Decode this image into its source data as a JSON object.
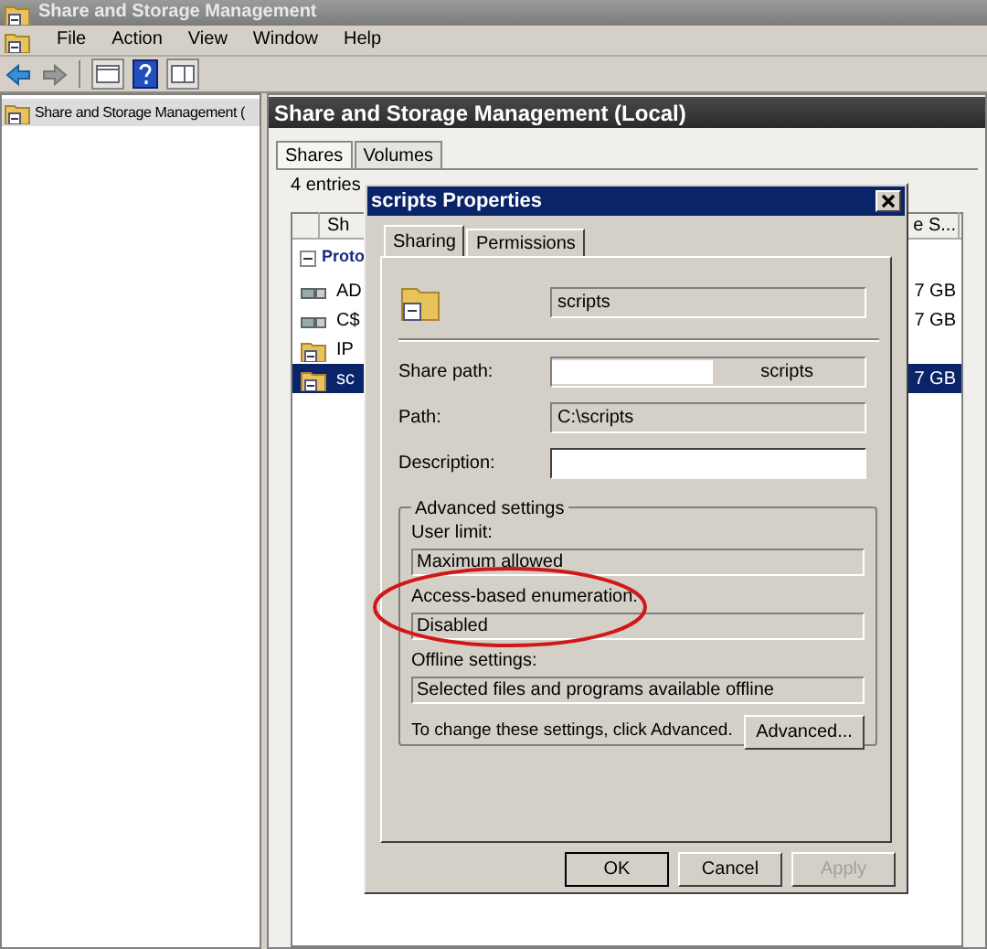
{
  "window": {
    "title": "Share and Storage Management"
  },
  "menu": [
    "File",
    "Action",
    "View",
    "Window",
    "Help"
  ],
  "tree": {
    "items": [
      {
        "label": "Share and Storage Management (",
        "selected": true
      }
    ]
  },
  "pane": {
    "title": "Share and Storage Management (Local)",
    "tabs": [
      {
        "label": "Shares",
        "selected": true
      },
      {
        "label": "Volumes",
        "selected": false
      }
    ],
    "count": "4 entries",
    "columns": [
      "Sh",
      "e S..."
    ],
    "group": "Proto",
    "rows": [
      {
        "name": "AD",
        "size": "7 GB",
        "selected": false,
        "kind": "share"
      },
      {
        "name": "C$",
        "size": "7 GB",
        "selected": false,
        "kind": "share"
      },
      {
        "name": "IP",
        "selected": false,
        "kind": "folder"
      },
      {
        "name": "sc",
        "size": "7 GB",
        "selected": true,
        "kind": "folder"
      }
    ]
  },
  "dialog": {
    "title": "scripts Properties",
    "tabs": [
      {
        "label": "Sharing",
        "selected": true
      },
      {
        "label": "Permissions",
        "selected": false
      }
    ],
    "share_name": "scripts",
    "fields": [
      {
        "label": "Share path:",
        "value": "scripts",
        "kind": "redacted"
      },
      {
        "label": "Path:",
        "value": "C:\\scripts",
        "kind": "readonly"
      },
      {
        "label": "Description:",
        "kind": "editable"
      }
    ],
    "advanced": {
      "legend": "Advanced settings",
      "settings": [
        {
          "label": "User limit:",
          "value": "Maximum allowed"
        },
        {
          "label": "Access-based enumeration:",
          "value": "Disabled"
        },
        {
          "label": "Offline settings:",
          "value": "Selected files and programs available offline"
        }
      ],
      "note": "To change these settings, click Advanced.",
      "button": "Advanced..."
    },
    "buttons": [
      {
        "label": "OK",
        "disabled": false,
        "default": true
      },
      {
        "label": "Cancel",
        "disabled": false,
        "default": false
      },
      {
        "label": "Apply",
        "disabled": true,
        "default": false
      }
    ]
  }
}
